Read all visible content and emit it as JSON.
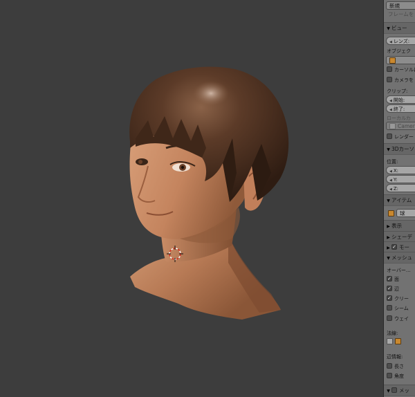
{
  "viewport": {
    "background": "#3d3d3d",
    "cursor_icon": "3d-cursor-icon"
  },
  "panel": {
    "top_button": "新規",
    "frame_field": "フレームを",
    "view_header": "ビュー",
    "lens_field": "レンズ:",
    "lock_object_label": "オブジェク",
    "cursor_lock_label": "カーソルに",
    "camera_lock_label": "カメラを",
    "clip_label": "クリップ:",
    "clip_start_field": "開始:",
    "clip_end_field": "終了:",
    "local_camera_label": "ローカルカ",
    "camera_field": "Camera",
    "render_region_label": "レンダー",
    "cursor_header": "3Dカーソ",
    "location_label": "位置:",
    "x_field": "X:",
    "y_field": "Y:",
    "z_field": "Z:",
    "item_header": "アイテム",
    "item_name": "球",
    "display_header": "表示",
    "shading_header": "シェーデ",
    "motion_header": "モー",
    "mesh_header": "メッシュ",
    "overlay_label": "オーバー...",
    "faces_label": "面",
    "edges_label": "辺",
    "crease_label": "クリー",
    "seams_label": "シーム",
    "weight_label": "ウェイ",
    "normals_label": "法線:",
    "edge_info_label": "辺情報:",
    "length_label": "長さ",
    "angle_label": "角度",
    "bottom_header": "メッ"
  }
}
